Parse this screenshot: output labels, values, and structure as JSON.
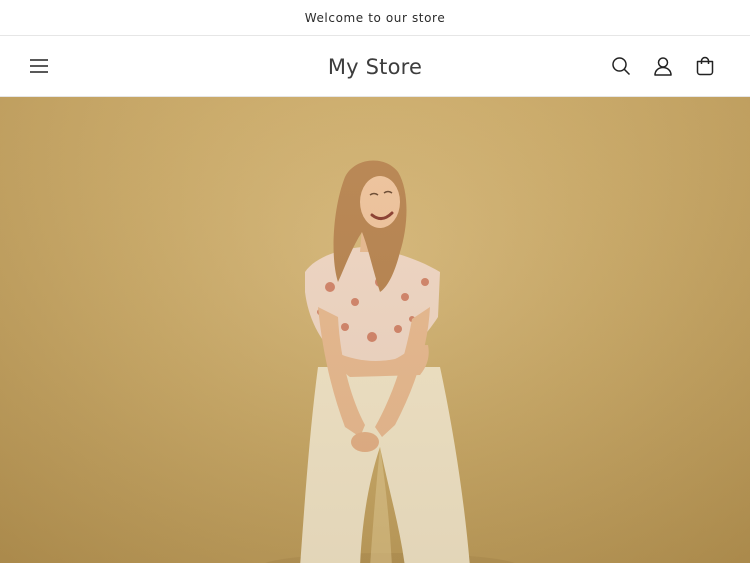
{
  "announcement": {
    "text": "Welcome to our store"
  },
  "header": {
    "logo": "My Store",
    "icons": {
      "menu": "hamburger-menu-icon",
      "search": "search-icon",
      "account": "account-icon",
      "cart": "cart-icon"
    }
  },
  "hero": {
    "image": "woman-in-floral-top-and-white-pants-on-mustard-background"
  },
  "colors": {
    "hero_background": "#c9a865",
    "text": "#121212",
    "border": "#e6e6e6"
  }
}
